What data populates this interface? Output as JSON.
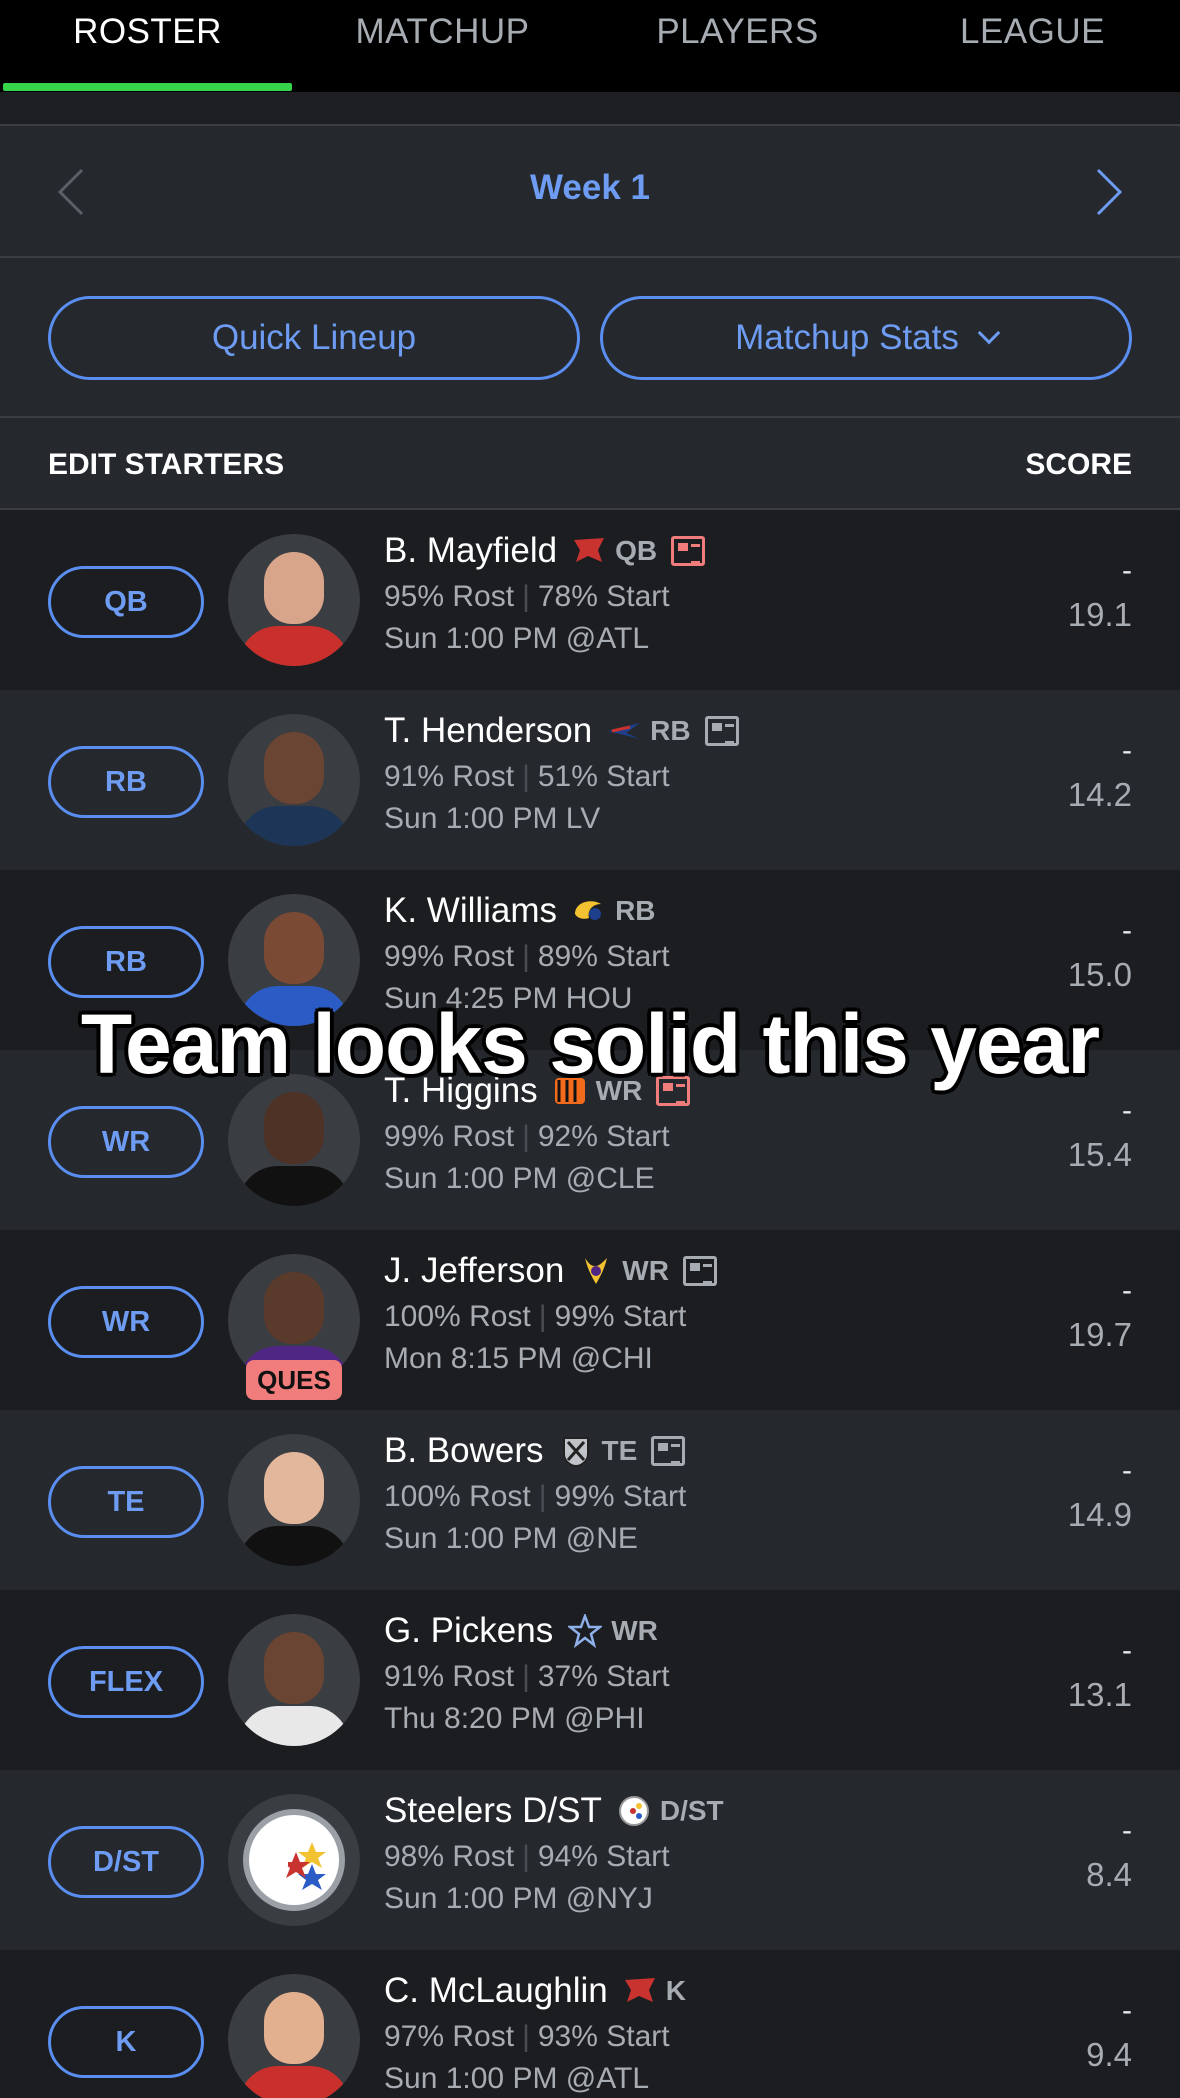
{
  "tabs": [
    "ROSTER",
    "MATCHUP",
    "PLAYERS",
    "LEAGUE"
  ],
  "week": {
    "label": "Week 1"
  },
  "actions": {
    "quick_lineup": "Quick Lineup",
    "matchup_stats": "Matchup Stats"
  },
  "header": {
    "left": "EDIT STARTERS",
    "right": "SCORE"
  },
  "rows": [
    {
      "slot": "QB",
      "name": "B. Mayfield",
      "team_icon": "buccaneers-logo",
      "pos": "QB",
      "news": "alert",
      "rost": "95% Rost",
      "start": "78% Start",
      "game": "Sun 1:00 PM @ATL",
      "score": "-",
      "proj": "19.1"
    },
    {
      "slot": "RB",
      "name": "T. Henderson",
      "team_icon": "patriots-logo",
      "pos": "RB",
      "news": "normal",
      "rost": "91% Rost",
      "start": "51% Start",
      "game": "Sun 1:00 PM LV",
      "score": "-",
      "proj": "14.2"
    },
    {
      "slot": "RB",
      "name": "K. Williams",
      "team_icon": "rams-logo",
      "pos": "RB",
      "news": "none",
      "rost": "99% Rost",
      "start": "89% Start",
      "game": "Sun 4:25 PM HOU",
      "score": "-",
      "proj": "15.0"
    },
    {
      "slot": "WR",
      "name": "T. Higgins",
      "team_icon": "bengals-logo",
      "pos": "WR",
      "news": "alert",
      "rost": "99% Rost",
      "start": "92% Start",
      "game": "Sun 1:00 PM @CLE",
      "score": "-",
      "proj": "15.4"
    },
    {
      "slot": "WR",
      "name": "J. Jefferson",
      "team_icon": "vikings-logo",
      "pos": "WR",
      "news": "normal",
      "rost": "100% Rost",
      "start": "99% Start",
      "game": "Mon 8:15 PM @CHI",
      "score": "-",
      "proj": "19.7",
      "status": "QUES"
    },
    {
      "slot": "TE",
      "name": "B. Bowers",
      "team_icon": "raiders-logo",
      "pos": "TE",
      "news": "normal",
      "rost": "100% Rost",
      "start": "99% Start",
      "game": "Sun 1:00 PM @NE",
      "score": "-",
      "proj": "14.9"
    },
    {
      "slot": "FLEX",
      "name": "G. Pickens",
      "team_icon": "cowboys-logo",
      "pos": "WR",
      "news": "none",
      "rost": "91% Rost",
      "start": "37% Start",
      "game": "Thu 8:20 PM @PHI",
      "score": "-",
      "proj": "13.1"
    },
    {
      "slot": "D/ST",
      "name": "Steelers D/ST",
      "team_icon": "steelers-logo",
      "pos": "D/ST",
      "news": "none",
      "rost": "98% Rost",
      "start": "94% Start",
      "game": "Sun 1:00 PM @NYJ",
      "score": "-",
      "proj": "8.4"
    },
    {
      "slot": "K",
      "name": "C. McLaughlin",
      "team_icon": "buccaneers-logo",
      "pos": "K",
      "news": "none",
      "rost": "97% Rost",
      "start": "93% Start",
      "game": "Sun 1:00 PM @ATL",
      "score": "-",
      "proj": "9.4"
    }
  ],
  "caption": "Team looks solid this year",
  "colors": {
    "accent": "#6d9cf2",
    "active_tab": "#35d44a",
    "alert": "#f07c7c"
  }
}
